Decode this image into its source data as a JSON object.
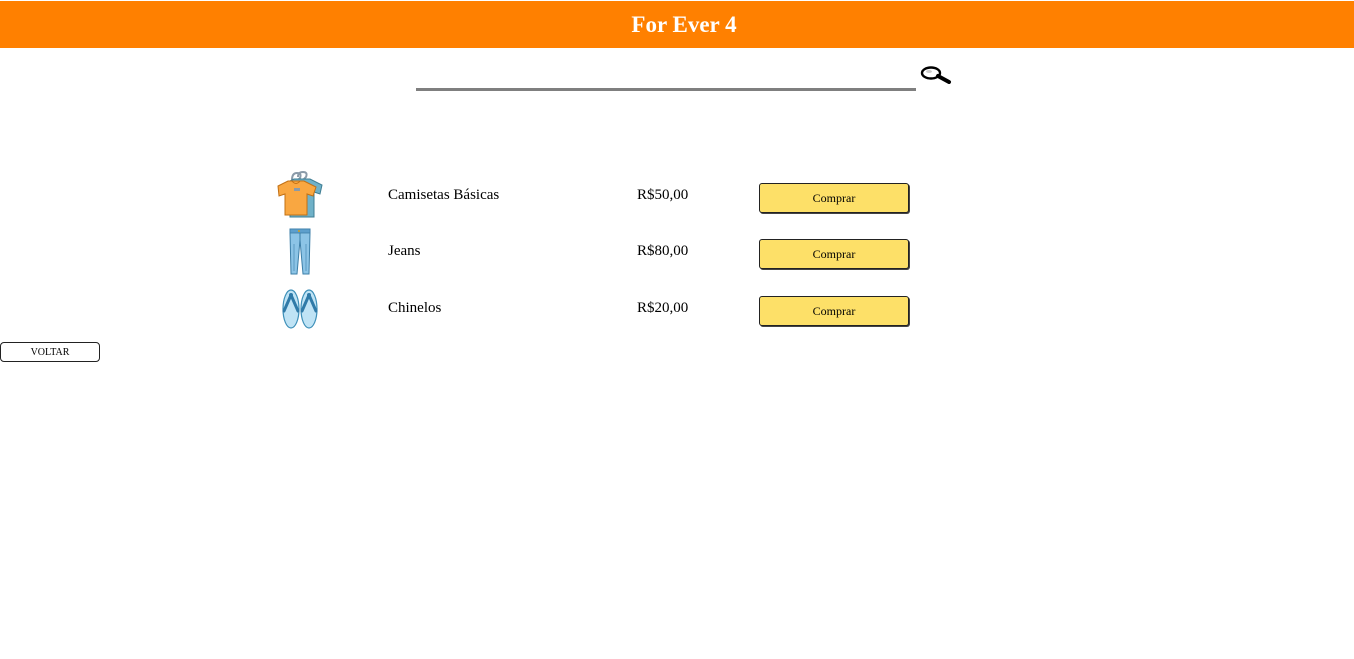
{
  "header": {
    "title": "For Ever 4",
    "background_color": "#ff8000"
  },
  "search": {
    "value": "",
    "placeholder": "",
    "icon": "magnifier-icon"
  },
  "products": [
    {
      "icon": "tshirt-icon",
      "name": "Camisetas Básicas",
      "price": "R$50,00",
      "button_label": "Comprar"
    },
    {
      "icon": "jeans-icon",
      "name": "Jeans",
      "price": "R$80,00",
      "button_label": "Comprar"
    },
    {
      "icon": "flip-flops-icon",
      "name": "Chinelos",
      "price": "R$20,00",
      "button_label": "Comprar"
    }
  ],
  "back_button": {
    "label": "VOLTAR"
  },
  "colors": {
    "button_yellow": "#fde068",
    "search_underline": "#7f7f7f"
  }
}
